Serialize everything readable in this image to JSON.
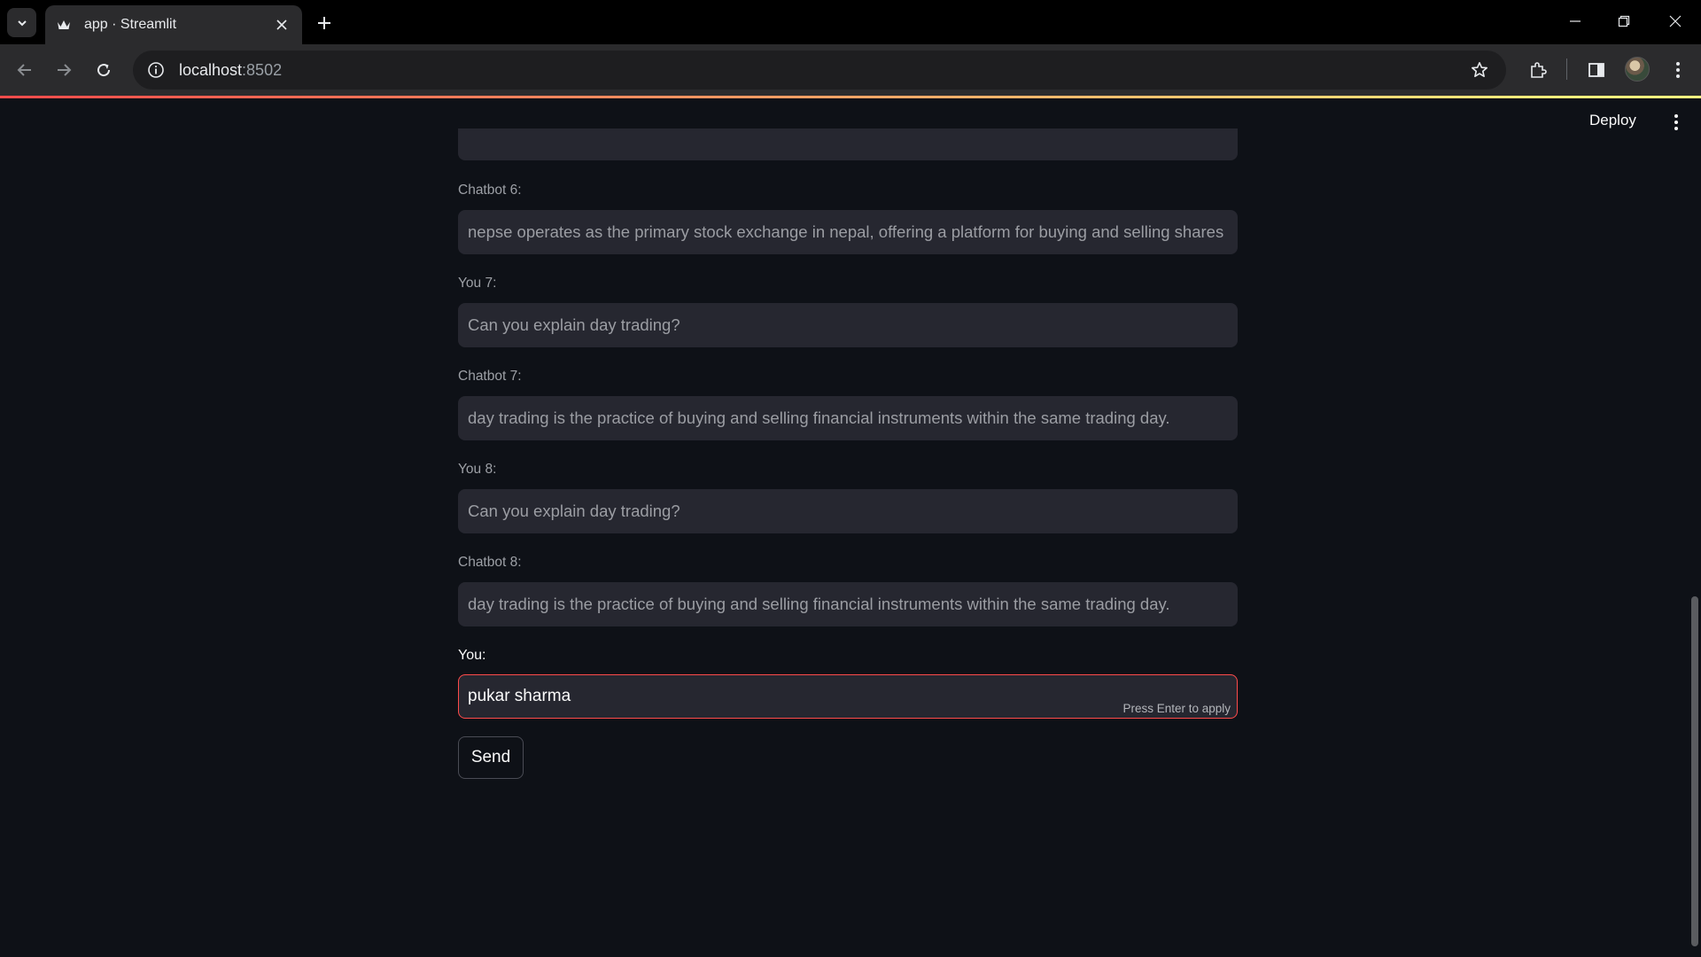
{
  "browser": {
    "tab_title": "app · Streamlit",
    "url_host": "localhost",
    "url_port": ":8502"
  },
  "header": {
    "deploy_label": "Deploy"
  },
  "chat": {
    "partial_top_value": "",
    "messages": [
      {
        "label": "Chatbot 6:",
        "value": "nepse operates as the primary stock exchange in nepal, offering a platform for buying and selling shares"
      },
      {
        "label": "You 7:",
        "value": "Can you explain day trading?"
      },
      {
        "label": "Chatbot 7:",
        "value": "day trading is the practice of buying and selling financial instruments within the same trading day."
      },
      {
        "label": "You 8:",
        "value": "Can you explain day trading?"
      },
      {
        "label": "Chatbot 8:",
        "value": "day trading is the practice of buying and selling financial instruments within the same trading day."
      }
    ]
  },
  "input": {
    "label": "You:",
    "value": "pukar sharma",
    "hint": "Press Enter to apply"
  },
  "send_label": "Send",
  "colors": {
    "accent": "#ff4b4b",
    "background": "#0e1117",
    "field_bg": "#262730"
  }
}
